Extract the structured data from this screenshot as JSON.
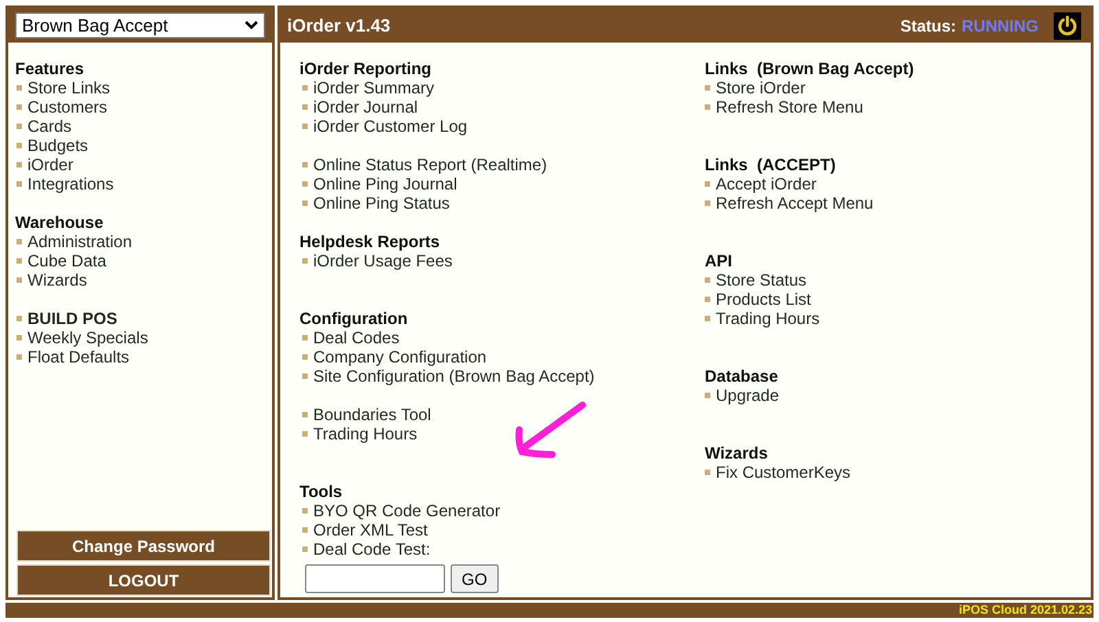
{
  "store_select": {
    "value": "Brown Bag Accept"
  },
  "header": {
    "title": "iOrder v1.43",
    "status_label": "Status:",
    "status_value": "RUNNING"
  },
  "sidebar": {
    "groups": [
      {
        "title": "Features",
        "items": [
          {
            "label": "Store Links",
            "kind": "link"
          },
          {
            "label": "Customers",
            "kind": "link"
          },
          {
            "label": "Cards",
            "kind": "link"
          },
          {
            "label": "Budgets",
            "kind": "link"
          },
          {
            "label": "iOrder",
            "kind": "link"
          },
          {
            "label": "Integrations",
            "kind": "link"
          }
        ]
      },
      {
        "title": "Warehouse",
        "items": [
          {
            "label": "Administration",
            "kind": "link"
          },
          {
            "label": "Cube Data",
            "kind": "link"
          },
          {
            "label": "Wizards",
            "kind": "link"
          }
        ]
      },
      {
        "items": [
          {
            "label": "BUILD POS",
            "kind": "bold-link"
          },
          {
            "label": "Weekly Specials",
            "kind": "link"
          },
          {
            "label": "Float Defaults",
            "kind": "link"
          }
        ]
      }
    ],
    "buttons": [
      "Change Password",
      "LOGOUT"
    ]
  },
  "columns": [
    {
      "groups": [
        {
          "title": "iOrder Reporting",
          "items": [
            "iOrder Summary",
            "iOrder Journal",
            "iOrder Customer Log"
          ]
        },
        {
          "items": [
            "Online Status Report (Realtime)",
            "Online Ping Journal",
            "Online Ping Status"
          ]
        },
        {
          "title": "Helpdesk Reports",
          "items": [
            "iOrder Usage Fees"
          ]
        },
        {
          "title": "Configuration",
          "items": [
            "Deal Codes",
            "Company Configuration",
            "Site Configuration (Brown Bag Accept)"
          ]
        },
        {
          "items": [
            "Boundaries Tool",
            "Trading Hours"
          ]
        },
        {
          "title": "Tools",
          "items": [
            "BYO QR Code Generator",
            "Order XML Test",
            "Deal Code Test:"
          ],
          "test_button": "GO"
        }
      ]
    },
    {
      "groups": [
        {
          "title": "Links  (Brown Bag Accept)",
          "items": [
            "Store iOrder",
            "Refresh Store Menu"
          ]
        },
        {
          "title": "Links  (ACCEPT)",
          "items": [
            "Accept iOrder",
            "Refresh Accept Menu"
          ]
        },
        {
          "title": "API",
          "items": [
            "Store Status",
            "Products List",
            "Trading Hours"
          ]
        },
        {
          "title": "Database",
          "items": [
            "Upgrade"
          ]
        },
        {
          "title": "Wizards",
          "items": [
            "Fix CustomerKeys"
          ]
        }
      ]
    }
  ],
  "footer": "iPOS Cloud 2021.02.23"
}
